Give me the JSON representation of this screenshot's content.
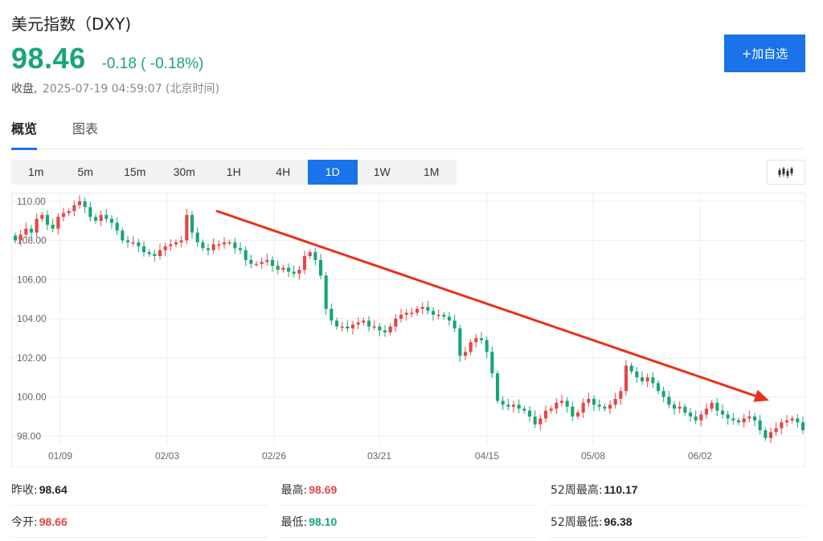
{
  "header": {
    "title": "美元指数（DXY)",
    "price": "98.46",
    "change": "-0.18 ( -0.18%)",
    "status_label": "收盘,",
    "timestamp": "2025-07-19 04:59:07 (北京时间)",
    "add_button": "+加自选"
  },
  "tabs": [
    {
      "label": "概览",
      "active": true
    },
    {
      "label": "图表",
      "active": false
    }
  ],
  "intervals": [
    "1m",
    "5m",
    "15m",
    "30m",
    "1H",
    "4H",
    "1D",
    "1W",
    "1M"
  ],
  "active_interval": "1D",
  "chart_type_icon": "candlestick-icon",
  "colors": {
    "up": "#e64545",
    "down": "#17a673",
    "accent": "#1a73e8",
    "trend_arrow": "#e8301c"
  },
  "chart_data": {
    "type": "candlestick",
    "y_ticks": [
      "110.00",
      "108.00",
      "106.00",
      "104.00",
      "102.00",
      "100.00",
      "98.00"
    ],
    "ylim": [
      97.6,
      110.4
    ],
    "x_ticks": [
      "01/09",
      "02/03",
      "02/26",
      "03/21",
      "04/15",
      "05/08",
      "06/02"
    ],
    "grid": true,
    "annotation": "red downward trend arrow from early Feb to mid June",
    "close_approx": [
      108.0,
      108.3,
      108.6,
      108.4,
      109.1,
      109.3,
      108.8,
      108.6,
      109.2,
      109.4,
      109.5,
      109.8,
      110.0,
      109.7,
      109.2,
      109.0,
      109.3,
      109.1,
      108.9,
      108.5,
      108.0,
      107.9,
      107.9,
      107.7,
      107.4,
      107.3,
      107.2,
      107.5,
      107.7,
      107.8,
      107.9,
      108.0,
      109.3,
      108.4,
      107.9,
      107.6,
      107.5,
      107.8,
      107.8,
      107.9,
      107.9,
      107.6,
      107.5,
      107.0,
      106.8,
      106.8,
      106.9,
      107.0,
      106.7,
      106.5,
      106.6,
      106.4,
      106.3,
      106.5,
      107.2,
      107.4,
      107.0,
      106.2,
      104.5,
      103.9,
      103.6,
      103.6,
      103.5,
      103.7,
      103.8,
      103.9,
      103.6,
      103.6,
      103.4,
      103.3,
      103.6,
      104.0,
      104.2,
      104.3,
      104.3,
      104.5,
      104.6,
      104.4,
      104.2,
      104.2,
      104.1,
      103.9,
      103.5,
      102.1,
      102.3,
      102.8,
      103.0,
      102.9,
      102.3,
      101.2,
      99.8,
      99.6,
      99.5,
      99.6,
      99.4,
      99.3,
      99.0,
      98.6,
      98.9,
      99.3,
      99.4,
      99.7,
      99.8,
      99.5,
      99.0,
      99.2,
      99.7,
      99.9,
      99.6,
      99.5,
      99.4,
      99.6,
      99.9,
      100.3,
      101.6,
      101.3,
      101.0,
      100.8,
      101.0,
      100.7,
      100.3,
      100.0,
      99.6,
      99.4,
      99.5,
      99.2,
      99.0,
      98.8,
      99.1,
      99.4,
      99.7,
      99.3,
      99.1,
      98.9,
      98.8,
      98.7,
      98.9,
      99.0,
      98.8,
      98.3,
      97.9,
      98.2,
      98.4,
      98.7,
      98.8,
      98.9,
      98.7,
      98.3
    ]
  },
  "stats": [
    [
      {
        "label": "昨收:",
        "value": "98.64",
        "color": "black"
      },
      {
        "label": "最高:",
        "value": "98.69",
        "color": "red"
      },
      {
        "label": "52周最高:",
        "value": "110.17",
        "color": "black"
      }
    ],
    [
      {
        "label": "今开:",
        "value": "98.66",
        "color": "red"
      },
      {
        "label": "最低:",
        "value": "98.10",
        "color": "green"
      },
      {
        "label": "52周最低:",
        "value": "96.38",
        "color": "black"
      }
    ]
  ]
}
